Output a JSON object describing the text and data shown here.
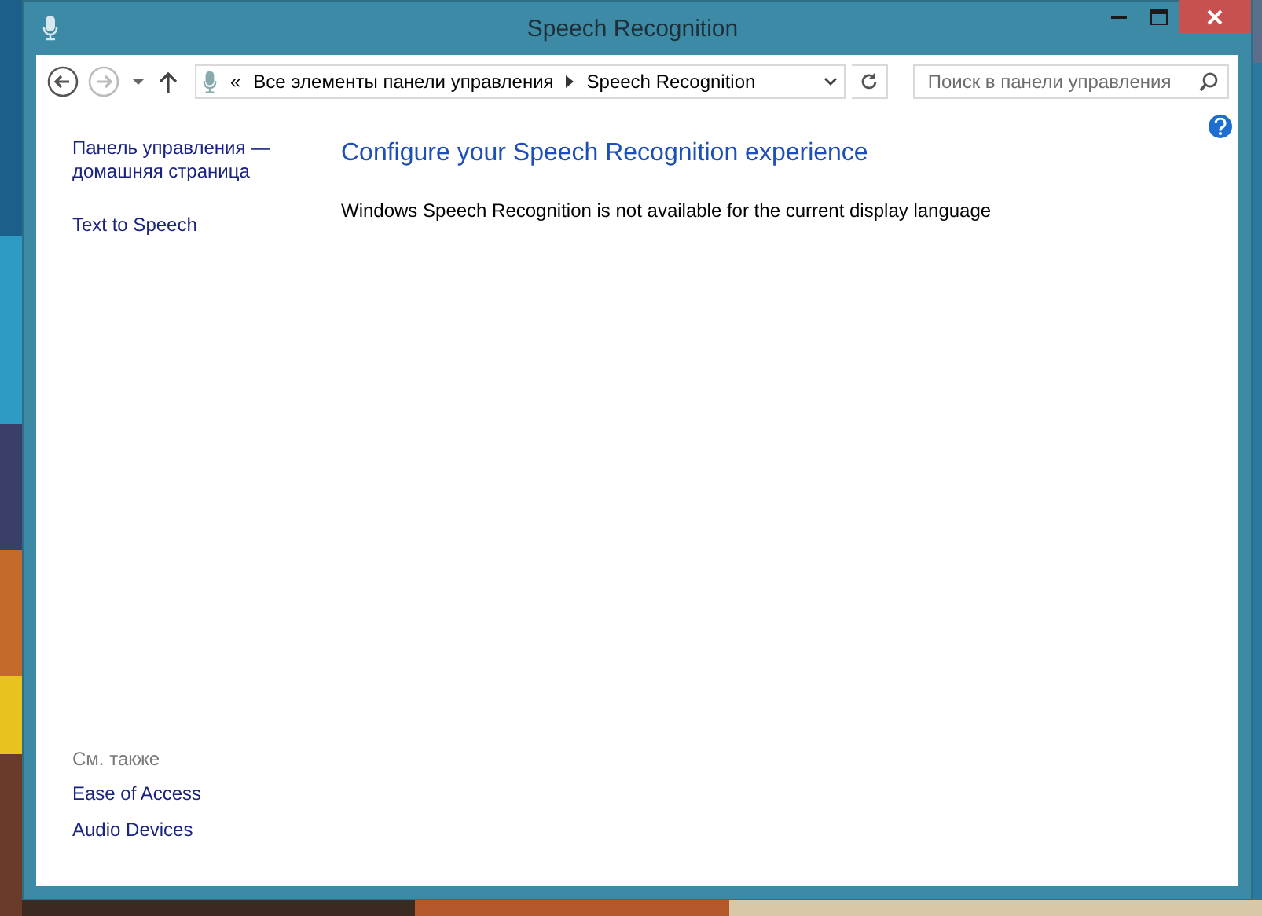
{
  "window": {
    "title": "Speech Recognition"
  },
  "address_bar": {
    "overflow": "«",
    "crumbs": [
      "Все элементы панели управления",
      "Speech Recognition"
    ]
  },
  "search": {
    "placeholder": "Поиск в панели управления"
  },
  "sidebar": {
    "links": [
      "Панель управления — домашняя страница",
      "Text to Speech"
    ],
    "see_also": {
      "heading": "См. также",
      "links": [
        "Ease of Access",
        "Audio Devices"
      ]
    }
  },
  "main": {
    "heading": "Configure your Speech Recognition experience",
    "message": "Windows Speech Recognition is not available for the current display language"
  }
}
